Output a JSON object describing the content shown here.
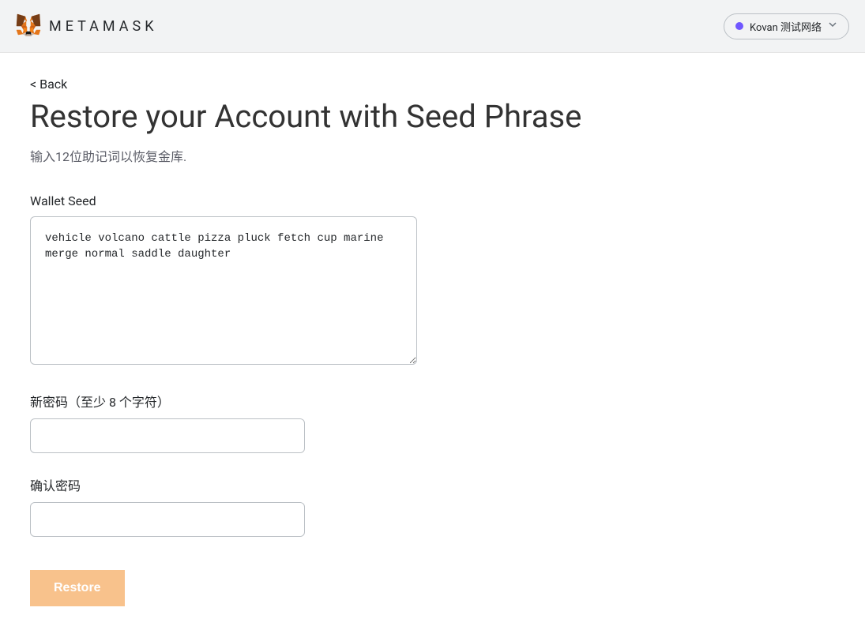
{
  "header": {
    "brand": "METAMASK",
    "network": {
      "label": "Kovan 测试网络",
      "color": "#7057ff"
    }
  },
  "back": {
    "label": "< Back"
  },
  "page": {
    "title": "Restore your Account with Seed Phrase",
    "subtitle": "输入12位助记词以恢复金库."
  },
  "seed": {
    "label": "Wallet Seed",
    "value": "vehicle volcano cattle pizza pluck fetch cup marine merge normal saddle daughter"
  },
  "newPassword": {
    "label": "新密码（至少 8 个字符）",
    "value": ""
  },
  "confirmPassword": {
    "label": "确认密码",
    "value": ""
  },
  "restoreButton": {
    "label": "Restore"
  }
}
